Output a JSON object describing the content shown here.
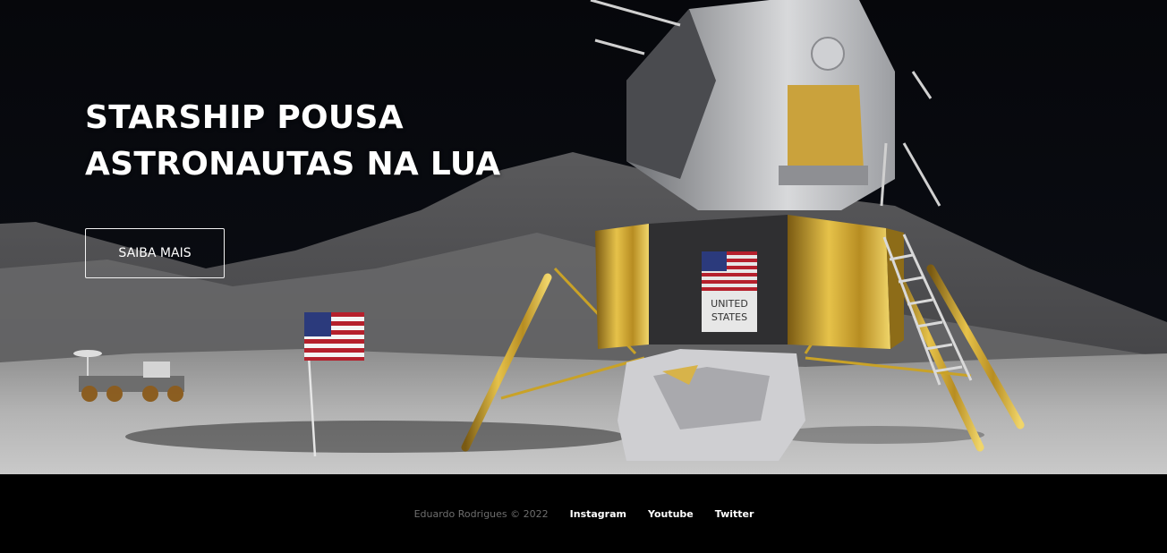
{
  "hero": {
    "title_line1": "STARSHIP POUSA",
    "title_line2": "ASTRONAUTAS NA LUA",
    "cta_label": "SAIBA MAIS",
    "flag_label_line1": "UNITED",
    "flag_label_line2": "STATES"
  },
  "footer": {
    "copyright": "Eduardo Rodrigues © 2022",
    "links": [
      {
        "label": "Instagram"
      },
      {
        "label": "Youtube"
      },
      {
        "label": "Twitter"
      }
    ]
  },
  "colors": {
    "background": "#000000",
    "text": "#ffffff",
    "muted_text": "#6e6e6e",
    "lunar_surface": "#b9b9b9",
    "gold_foil": "#c9a227"
  }
}
